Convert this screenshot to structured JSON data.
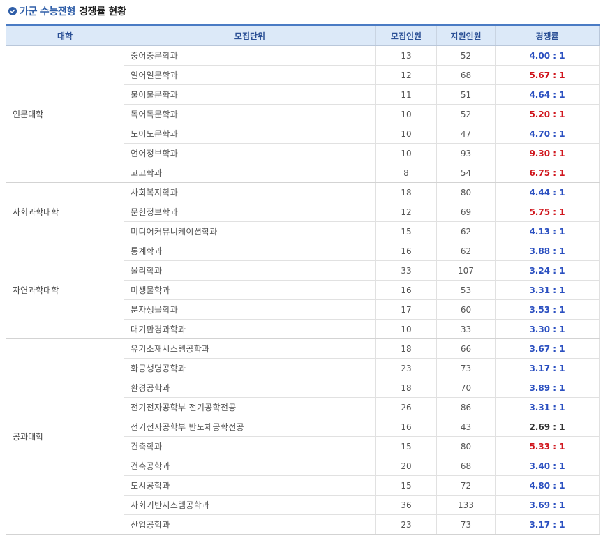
{
  "heading": {
    "highlight": "가군 수능전형",
    "rest": "경쟁률 현황",
    "icon": "check-circle-icon"
  },
  "colors": {
    "blue": "#2a4fc0",
    "red": "#d0161d",
    "dark": "#333333",
    "header_bg": "#dce9f8"
  },
  "table": {
    "headers": [
      "대학",
      "모집단위",
      "모집인원",
      "지원인원",
      "경쟁률"
    ],
    "groups": [
      {
        "college": "인문대학",
        "rows": [
          {
            "unit": "중어중문학과",
            "quota": "13",
            "applicants": "52",
            "rate": "4.00 : 1",
            "color": "blue"
          },
          {
            "unit": "일어일문학과",
            "quota": "12",
            "applicants": "68",
            "rate": "5.67 : 1",
            "color": "red"
          },
          {
            "unit": "불어불문학과",
            "quota": "11",
            "applicants": "51",
            "rate": "4.64 : 1",
            "color": "blue"
          },
          {
            "unit": "독어독문학과",
            "quota": "10",
            "applicants": "52",
            "rate": "5.20 : 1",
            "color": "red"
          },
          {
            "unit": "노어노문학과",
            "quota": "10",
            "applicants": "47",
            "rate": "4.70 : 1",
            "color": "blue"
          },
          {
            "unit": "언어정보학과",
            "quota": "10",
            "applicants": "93",
            "rate": "9.30 : 1",
            "color": "red"
          },
          {
            "unit": "고고학과",
            "quota": "8",
            "applicants": "54",
            "rate": "6.75 : 1",
            "color": "red"
          }
        ]
      },
      {
        "college": "사회과학대학",
        "rows": [
          {
            "unit": "사회복지학과",
            "quota": "18",
            "applicants": "80",
            "rate": "4.44 : 1",
            "color": "blue"
          },
          {
            "unit": "문헌정보학과",
            "quota": "12",
            "applicants": "69",
            "rate": "5.75 : 1",
            "color": "red"
          },
          {
            "unit": "미디어커뮤니케이션학과",
            "quota": "15",
            "applicants": "62",
            "rate": "4.13 : 1",
            "color": "blue"
          }
        ]
      },
      {
        "college": "자연과학대학",
        "rows": [
          {
            "unit": "통계학과",
            "quota": "16",
            "applicants": "62",
            "rate": "3.88 : 1",
            "color": "blue"
          },
          {
            "unit": "물리학과",
            "quota": "33",
            "applicants": "107",
            "rate": "3.24 : 1",
            "color": "blue"
          },
          {
            "unit": "미생물학과",
            "quota": "16",
            "applicants": "53",
            "rate": "3.31 : 1",
            "color": "blue"
          },
          {
            "unit": "분자생물학과",
            "quota": "17",
            "applicants": "60",
            "rate": "3.53 : 1",
            "color": "blue"
          },
          {
            "unit": "대기환경과학과",
            "quota": "10",
            "applicants": "33",
            "rate": "3.30 : 1",
            "color": "blue"
          }
        ]
      },
      {
        "college": "공과대학",
        "rows": [
          {
            "unit": "유기소재시스템공학과",
            "quota": "18",
            "applicants": "66",
            "rate": "3.67 : 1",
            "color": "blue"
          },
          {
            "unit": "화공생명공학과",
            "quota": "23",
            "applicants": "73",
            "rate": "3.17 : 1",
            "color": "blue"
          },
          {
            "unit": "환경공학과",
            "quota": "18",
            "applicants": "70",
            "rate": "3.89 : 1",
            "color": "blue"
          },
          {
            "unit": "전기전자공학부 전기공학전공",
            "quota": "26",
            "applicants": "86",
            "rate": "3.31 : 1",
            "color": "blue"
          },
          {
            "unit": "전기전자공학부 반도체공학전공",
            "quota": "16",
            "applicants": "43",
            "rate": "2.69 : 1",
            "color": "dark"
          },
          {
            "unit": "건축학과",
            "quota": "15",
            "applicants": "80",
            "rate": "5.33 : 1",
            "color": "red"
          },
          {
            "unit": "건축공학과",
            "quota": "20",
            "applicants": "68",
            "rate": "3.40 : 1",
            "color": "blue"
          },
          {
            "unit": "도시공학과",
            "quota": "15",
            "applicants": "72",
            "rate": "4.80 : 1",
            "color": "blue"
          },
          {
            "unit": "사회기반시스템공학과",
            "quota": "36",
            "applicants": "133",
            "rate": "3.69 : 1",
            "color": "blue"
          },
          {
            "unit": "산업공학과",
            "quota": "23",
            "applicants": "73",
            "rate": "3.17 : 1",
            "color": "blue"
          }
        ]
      }
    ]
  }
}
